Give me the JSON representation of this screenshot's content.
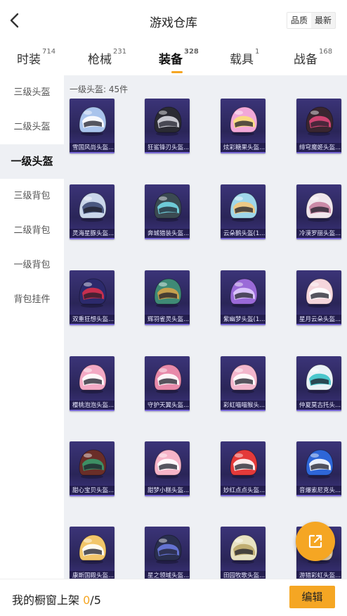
{
  "header": {
    "title": "游戏仓库",
    "sort": [
      "品质",
      "最新"
    ],
    "sort_active": 0
  },
  "tabs": [
    {
      "label": "时装",
      "count": "714"
    },
    {
      "label": "枪械",
      "count": "231"
    },
    {
      "label": "装备",
      "count": "328"
    },
    {
      "label": "载具",
      "count": "1"
    },
    {
      "label": "战备",
      "count": "168"
    }
  ],
  "active_tab": 2,
  "sidebar": {
    "items": [
      "三级头盔",
      "二级头盔",
      "一级头盔",
      "三级背包",
      "二级背包",
      "一级背包",
      "背包挂件"
    ],
    "active": 2
  },
  "section": {
    "label": "一级头盔: 45件"
  },
  "items": [
    {
      "name": "雪国风尚头盔...",
      "color": "#a9c4ec",
      "accent": "#ffffff"
    },
    {
      "name": "狂鲨锋刃头盔...",
      "color": "#2b2b33",
      "accent": "#d8d8e0"
    },
    {
      "name": "炫彩糖果头盔...",
      "color": "#f2a8d8",
      "accent": "#fbe07a"
    },
    {
      "name": "绯穹魔姬头盔...",
      "color": "#3a2630",
      "accent": "#e0487a"
    },
    {
      "name": "灵海星豚头盔...",
      "color": "#c9d6ea",
      "accent": "#3c4a74"
    },
    {
      "name": "奔城猎装头盔...",
      "color": "#3b4a52",
      "accent": "#74d8e6"
    },
    {
      "name": "云朵鹅头盔(1...",
      "color": "#9fd7ea",
      "accent": "#f4c87a"
    },
    {
      "name": "冷漠罗丽头盔...",
      "color": "#f0e6ec",
      "accent": "#c77fa0"
    },
    {
      "name": "双重狂想头盔...",
      "color": "#2c2a6c",
      "accent": "#d8304c"
    },
    {
      "name": "辉羽雀灵头盔...",
      "color": "#3f8a76",
      "accent": "#d4a24a"
    },
    {
      "name": "紫幽梦头盔(1...",
      "color": "#9a6ad8",
      "accent": "#e0ccff"
    },
    {
      "name": "星月云朵头盔...",
      "color": "#f5d6dc",
      "accent": "#ffffff"
    },
    {
      "name": "樱桃泡泡头盔...",
      "color": "#f3a9c4",
      "accent": "#ffffff"
    },
    {
      "name": "守护天翼头盔...",
      "color": "#e88aaa",
      "accent": "#ffffff"
    },
    {
      "name": "彩虹喵喵猴头...",
      "color": "#f2b6cc",
      "accent": "#ffffff"
    },
    {
      "name": "仲夏莫古托头...",
      "color": "#eaf2f6",
      "accent": "#3ac2c8"
    },
    {
      "name": "甜心宝贝头盔...",
      "color": "#6a2e28",
      "accent": "#3a9a6a"
    },
    {
      "name": "甜梦小糕头盔...",
      "color": "#f6b4c8",
      "accent": "#ffffff"
    },
    {
      "name": "妙红点点头盔...",
      "color": "#e43a3a",
      "accent": "#ffffff"
    },
    {
      "name": "音爆索尼克头...",
      "color": "#2e66d8",
      "accent": "#ffffff"
    },
    {
      "name": "康斯国殿头盔...",
      "color": "#f2c66a",
      "accent": "#ffffff"
    },
    {
      "name": "星之领域头盔...",
      "color": "#2a2f4e",
      "accent": "#6a7ae0"
    },
    {
      "name": "田园牧歌头盔...",
      "color": "#e8e2c2",
      "accent": "#bba86a"
    },
    {
      "name": "游猎彩虹头盔...",
      "color": "#e6d2b0",
      "accent": "#ffffff"
    }
  ],
  "bottom": {
    "label": "我的橱窗上架",
    "count": "0",
    "total": "/5",
    "edit": "编辑"
  },
  "colors": {
    "accent": "#f5a623",
    "card_bg": "#2a2558",
    "content_bg": "#eef0f4"
  },
  "icons": {
    "back": "chevron-left-icon",
    "share": "external-link-icon"
  }
}
